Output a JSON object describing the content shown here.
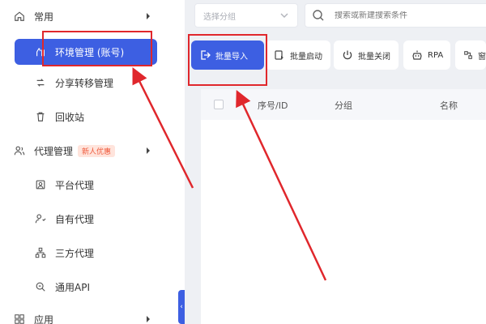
{
  "sidebar": {
    "common": "常用",
    "env_mgmt": "环境管理 (账号)",
    "share_transfer": "分享转移管理",
    "recycle_bin": "回收站",
    "proxy_mgmt": "代理管理",
    "proxy_badge": "新人优惠",
    "platform_proxy": "平台代理",
    "own_proxy": "自有代理",
    "third_party_proxy": "三方代理",
    "general_api": "通用API",
    "apps": "应用"
  },
  "filter": {
    "group_select_placeholder": "选择分组",
    "search_placeholder": "搜索或新建搜索条件"
  },
  "toolbar": {
    "batch_import": "批量导入",
    "batch_start": "批量启动",
    "batch_close": "批量关闭",
    "rpa": "RPA",
    "more": "窗"
  },
  "table": {
    "columns": [
      "序号/ID",
      "分组",
      "名称"
    ]
  },
  "colors": {
    "accent": "#3d5fe2",
    "annotation": "#e0272c",
    "badge_bg": "#ffe4dc",
    "badge_text": "#ef5a3c"
  }
}
